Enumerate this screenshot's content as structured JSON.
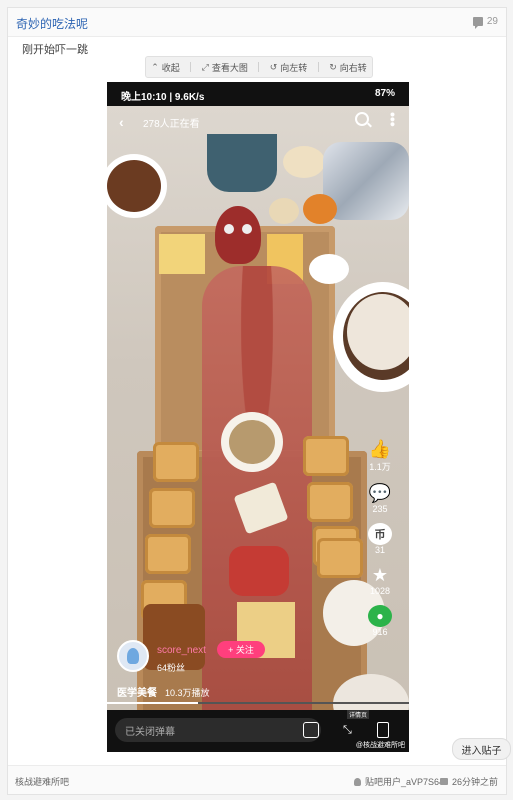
{
  "post": {
    "title": "奇妙的吃法呢",
    "reply_count": "29",
    "text": "刚开始吓一跳"
  },
  "toolbar": {
    "collapse": "收起",
    "view_large": "查看大图",
    "rotate_left": "向左转",
    "rotate_right": "向右转"
  },
  "video": {
    "status_time": "晚上10:10 | 9.6K/s",
    "status_battery": "87%",
    "viewers": "278人正在看",
    "side_actions": [
      {
        "icon": "thumbs-up-icon",
        "count": "1.1万"
      },
      {
        "icon": "comment-icon",
        "count": "235"
      },
      {
        "icon": "coin-icon",
        "count": "31"
      },
      {
        "icon": "star-icon",
        "count": "1028"
      },
      {
        "icon": "wechat-icon",
        "count": "916"
      }
    ],
    "username": "score_next",
    "follow_label": "+ 关注",
    "fans": "64粉丝",
    "tag": "医学美餐",
    "plays": "10.3万播放",
    "progress": 0.3,
    "danmaku_placeholder": "已关闭弹幕",
    "fullscreen_label": "详情页",
    "watermark": "@核战避难所吧"
  },
  "enter_post": "进入贴子",
  "footer": {
    "forum": "核战避难所吧",
    "user": "贴吧用户_aVP7S64",
    "time": "26分钟之前"
  },
  "colors": {
    "title_link": "#2d64b3",
    "follow_button": "#ff3f7d",
    "username": "#ff7aa8"
  }
}
